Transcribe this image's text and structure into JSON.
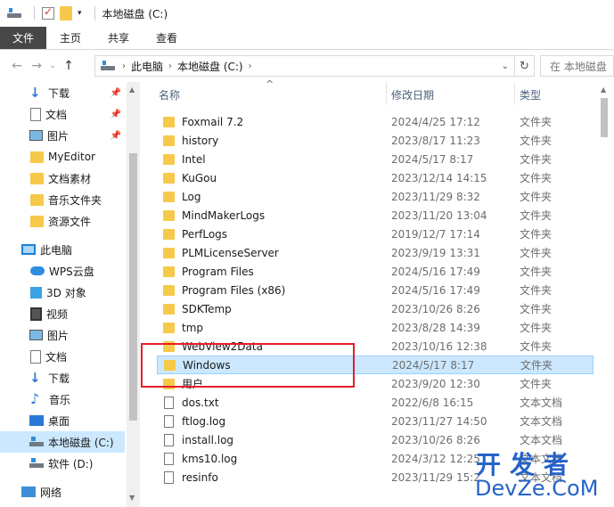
{
  "window": {
    "title": "本地磁盘 (C:)"
  },
  "ribbon": {
    "tabs": [
      "文件",
      "主页",
      "共享",
      "查看"
    ]
  },
  "address": {
    "crumbs": [
      "此电脑",
      "本地磁盘 (C:)"
    ],
    "search_placeholder": "在 本地磁盘"
  },
  "sidebar": {
    "quick_access": [
      {
        "label": "下载",
        "icon": "download-icon",
        "pinned": true
      },
      {
        "label": "文档",
        "icon": "document-icon",
        "pinned": true
      },
      {
        "label": "图片",
        "icon": "picture-icon",
        "pinned": true
      },
      {
        "label": "MyEditor",
        "icon": "folder-icon",
        "pinned": false
      },
      {
        "label": "文档素材",
        "icon": "folder-icon",
        "pinned": false
      },
      {
        "label": "音乐文件夹",
        "icon": "folder-icon",
        "pinned": false
      },
      {
        "label": "资源文件",
        "icon": "folder-icon",
        "pinned": false
      }
    ],
    "this_pc": "此电脑",
    "pc_items": [
      {
        "label": "WPS云盘",
        "icon": "cloud-icon"
      },
      {
        "label": "3D 对象",
        "icon": "cube-icon"
      },
      {
        "label": "视频",
        "icon": "video-icon"
      },
      {
        "label": "图片",
        "icon": "picture-icon"
      },
      {
        "label": "文档",
        "icon": "document-icon"
      },
      {
        "label": "下载",
        "icon": "download-icon"
      },
      {
        "label": "音乐",
        "icon": "music-icon"
      },
      {
        "label": "桌面",
        "icon": "desktop-icon"
      },
      {
        "label": "本地磁盘 (C:)",
        "icon": "drive-icon"
      },
      {
        "label": "软件 (D:)",
        "icon": "drive-icon"
      }
    ],
    "network": "网络"
  },
  "columns": {
    "name": "名称",
    "date": "修改日期",
    "type": "类型"
  },
  "files": [
    {
      "name": "Foxmail 7.2",
      "date": "2024/4/25 17:12",
      "type": "文件夹",
      "kind": "folder"
    },
    {
      "name": "history",
      "date": "2023/8/17 11:23",
      "type": "文件夹",
      "kind": "folder"
    },
    {
      "name": "Intel",
      "date": "2024/5/17 8:17",
      "type": "文件夹",
      "kind": "folder"
    },
    {
      "name": "KuGou",
      "date": "2023/12/14 14:15",
      "type": "文件夹",
      "kind": "folder"
    },
    {
      "name": "Log",
      "date": "2023/11/29 8:32",
      "type": "文件夹",
      "kind": "folder"
    },
    {
      "name": "MindMakerLogs",
      "date": "2023/11/20 13:04",
      "type": "文件夹",
      "kind": "folder"
    },
    {
      "name": "PerfLogs",
      "date": "2019/12/7 17:14",
      "type": "文件夹",
      "kind": "folder"
    },
    {
      "name": "PLMLicenseServer",
      "date": "2023/9/19 13:31",
      "type": "文件夹",
      "kind": "folder"
    },
    {
      "name": "Program Files",
      "date": "2024/5/16 17:49",
      "type": "文件夹",
      "kind": "folder"
    },
    {
      "name": "Program Files (x86)",
      "date": "2024/5/16 17:49",
      "type": "文件夹",
      "kind": "folder"
    },
    {
      "name": "SDKTemp",
      "date": "2023/10/26 8:26",
      "type": "文件夹",
      "kind": "folder"
    },
    {
      "name": "tmp",
      "date": "2023/8/28 14:39",
      "type": "文件夹",
      "kind": "folder"
    },
    {
      "name": "WebView2Data",
      "date": "2023/10/16 12:38",
      "type": "文件夹",
      "kind": "folder"
    },
    {
      "name": "Windows",
      "date": "2024/5/17 8:17",
      "type": "文件夹",
      "kind": "folder",
      "selected": true
    },
    {
      "name": "用户",
      "date": "2023/9/20 12:30",
      "type": "文件夹",
      "kind": "folder"
    },
    {
      "name": "dos.txt",
      "date": "2022/6/8 16:15",
      "type": "文本文档",
      "kind": "text"
    },
    {
      "name": "ftlog.log",
      "date": "2023/11/27 14:50",
      "type": "文本文档",
      "kind": "text"
    },
    {
      "name": "install.log",
      "date": "2023/10/26 8:26",
      "type": "文本文档",
      "kind": "text"
    },
    {
      "name": "kms10.log",
      "date": "2024/3/12 12:25",
      "type": "文本文档",
      "kind": "text"
    },
    {
      "name": "resinfo",
      "date": "2023/11/29 15:2",
      "type": "文本文档",
      "kind": "text"
    }
  ],
  "watermark": {
    "line1": "开发者",
    "line2": "DevZe.CoM"
  },
  "colors": {
    "selection": "#cce8ff",
    "highlight_box": "#e3202a",
    "watermark": "#2563c9"
  }
}
